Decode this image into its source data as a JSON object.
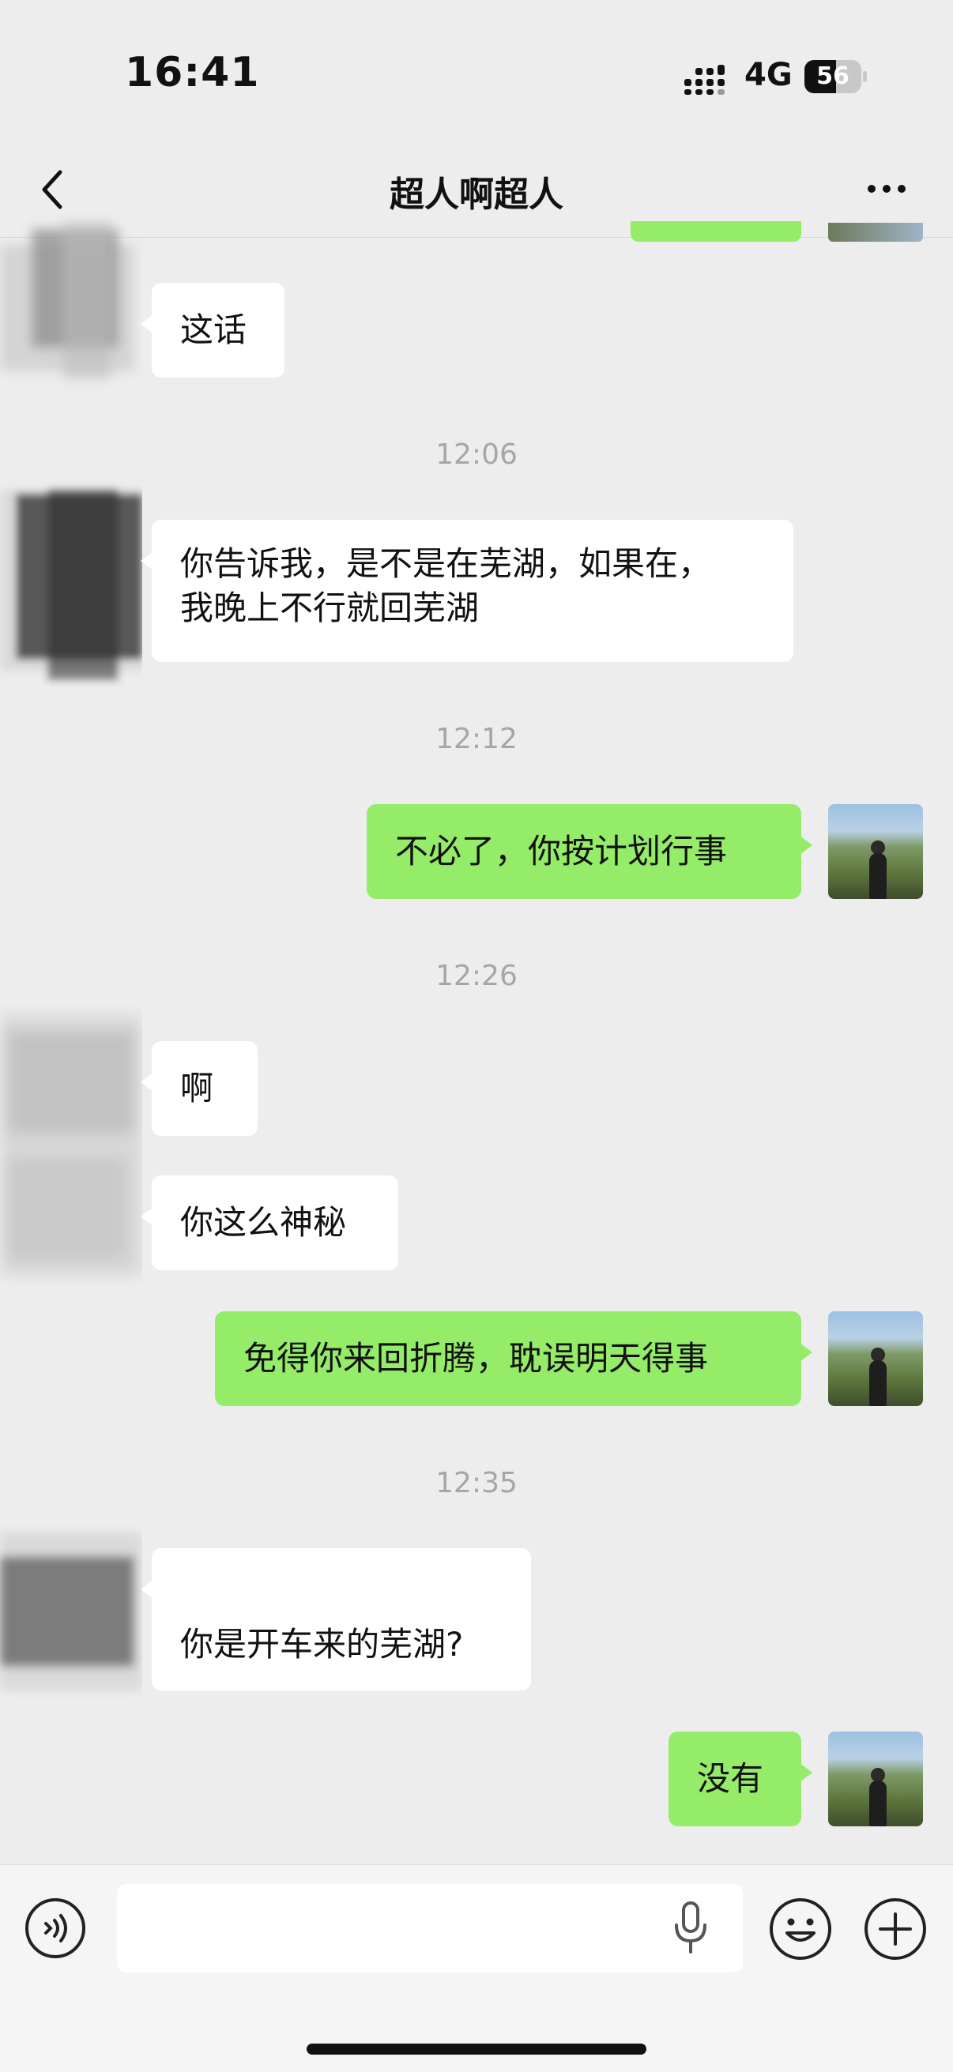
{
  "status_bar": {
    "time": "16:41",
    "network": "4G",
    "battery": "56",
    "battery_level": 0.56
  },
  "header": {
    "title": "超人啊超人"
  },
  "messages": [
    {
      "side": "left",
      "text": "这话"
    },
    {
      "timestamp": "12:06"
    },
    {
      "side": "left",
      "text": "你告诉我，是不是在芜湖，如果在，\n我晚上不行就回芜湖"
    },
    {
      "timestamp": "12:12"
    },
    {
      "side": "right",
      "text": "不必了，你按计划行事"
    },
    {
      "timestamp": "12:26"
    },
    {
      "side": "left",
      "text": "啊"
    },
    {
      "side": "left",
      "text": "你这么神秘"
    },
    {
      "side": "right",
      "text": "免得你来回折腾，耽误明天得事"
    },
    {
      "timestamp": "12:35"
    },
    {
      "side": "left",
      "text": "你是开车来的芜湖?"
    },
    {
      "side": "right",
      "text": "没有"
    }
  ],
  "icons": {
    "back": "chevron-left-icon",
    "more": "more-dots-icon",
    "voice": "voice-icon",
    "mic": "microphone-icon",
    "emoji": "emoji-icon",
    "plus": "plus-icon"
  },
  "colors": {
    "background": "#ededed",
    "outgoing_bubble": "#95ec69",
    "incoming_bubble": "#ffffff",
    "timestamp": "#a6a6a6"
  }
}
